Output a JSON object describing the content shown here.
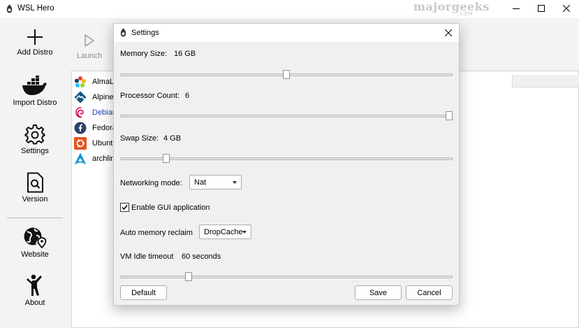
{
  "window": {
    "title": "WSL Hero",
    "watermark": "majorgeeks",
    "watermark_sub": ".COM"
  },
  "sidebar": {
    "items": [
      {
        "label": "Add Distro",
        "icon": "plus-icon"
      },
      {
        "label": "Import Distro",
        "icon": "docker-icon"
      },
      {
        "label": "Settings",
        "icon": "gear-icon"
      },
      {
        "label": "Version",
        "icon": "document-search-icon"
      },
      {
        "label": "Website",
        "icon": "globe-pin-icon"
      },
      {
        "label": "About",
        "icon": "person-icon"
      }
    ]
  },
  "toolbar": {
    "launch_label": "Launch"
  },
  "distros": [
    {
      "name": "AlmaL",
      "icon": "almalinux-icon",
      "color": "#e8452c"
    },
    {
      "name": "Alpine",
      "icon": "alpine-icon",
      "color": "#0d597f"
    },
    {
      "name": "Debian",
      "icon": "debian-icon",
      "color": "#d70a53"
    },
    {
      "name": "Fedora",
      "icon": "fedora-icon",
      "color": "#294172"
    },
    {
      "name": "Ubuntu",
      "icon": "ubuntu-icon",
      "color": "#e95420"
    },
    {
      "name": "archlin",
      "icon": "arch-icon",
      "color": "#1793d1"
    }
  ],
  "selected_distro": "Debian",
  "dialog": {
    "title": "Settings",
    "memory": {
      "label": "Memory Size:",
      "value": "16 GB",
      "level": 0.5
    },
    "processor": {
      "label": "Processor Count:",
      "value": "6",
      "level": 1.0
    },
    "swap": {
      "label": "Swap Size:",
      "value": "4 GB",
      "level": 0.13
    },
    "networking": {
      "label": "Networking mode:",
      "value": "Nat"
    },
    "gui": {
      "label": "Enable GUI application",
      "checked": true
    },
    "reclaim": {
      "label": "Auto memory reclaim",
      "value": "DropCache"
    },
    "idle": {
      "label": "VM Idle timeout",
      "value": "60 seconds",
      "level": 0.2
    },
    "buttons": {
      "default": "Default",
      "save": "Save",
      "cancel": "Cancel"
    }
  }
}
